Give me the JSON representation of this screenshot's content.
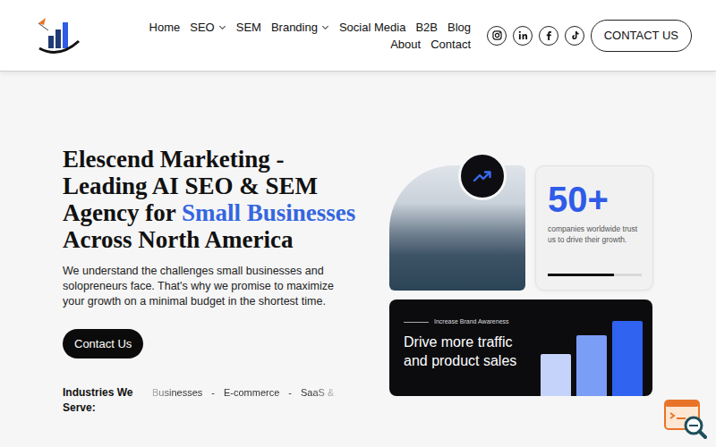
{
  "nav": {
    "items": [
      {
        "label": "Home",
        "kind": "link"
      },
      {
        "label": "SEO",
        "kind": "dropdown"
      },
      {
        "label": "SEM",
        "kind": "link"
      },
      {
        "label": "Branding",
        "kind": "dropdown"
      },
      {
        "label": "Social Media",
        "kind": "link"
      },
      {
        "label": "B2B",
        "kind": "link"
      },
      {
        "label": "Blog",
        "kind": "link"
      },
      {
        "label": "About",
        "kind": "link"
      },
      {
        "label": "Contact",
        "kind": "link"
      }
    ],
    "button": "CONTACT US"
  },
  "hero": {
    "title_before": "Elescend Marketing - Leading AI SEO & SEM Agency for ",
    "title_highlight": "Small Businesses",
    "title_after": " Across North America",
    "text": "We understand the challenges small businesses and solopreneurs face. That's why we promise to maximize your growth on a minimal budget in the shortest time.",
    "button": "Contact Us"
  },
  "industries": {
    "label": "Industries We Serve:",
    "separator": "-",
    "items": [
      "Businesses",
      "E-commerce",
      "SaaS &"
    ]
  },
  "stats": {
    "value": "50+",
    "caption": "companies worldwide trust us to drive their growth.",
    "level": 0.7
  },
  "promo": {
    "eyebrow": "Increase Brand Awareness",
    "title": "Drive more traffic and product sales",
    "bars": [
      47,
      68,
      84
    ]
  }
}
